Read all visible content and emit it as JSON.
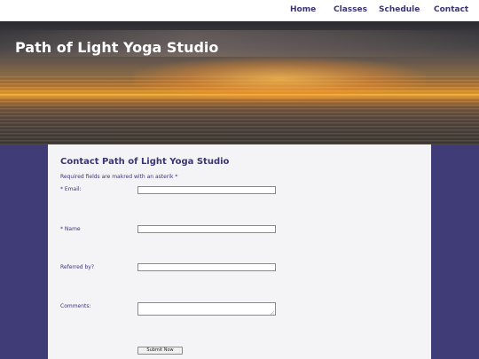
{
  "nav": {
    "items": [
      {
        "label": "Home"
      },
      {
        "label": "Classes"
      },
      {
        "label": "Schedule"
      },
      {
        "label": "Contact"
      }
    ]
  },
  "hero": {
    "title": "Path of Light Yoga Studio"
  },
  "form": {
    "title": "Contact Path of Light Yoga Studio",
    "note": "Required fields are makred with an asterik *",
    "fields": [
      {
        "label": "* Email:",
        "value": ""
      },
      {
        "label": "* Name",
        "value": ""
      },
      {
        "label": "Referred by?",
        "value": ""
      },
      {
        "label": "Comments:",
        "value": ""
      }
    ],
    "submit_label": "Submit Now"
  },
  "colors": {
    "brand_text": "#3b3572",
    "page_background": "#3f3c78",
    "content_background": "#f4f3f6",
    "nav_background": "#ffffff"
  }
}
